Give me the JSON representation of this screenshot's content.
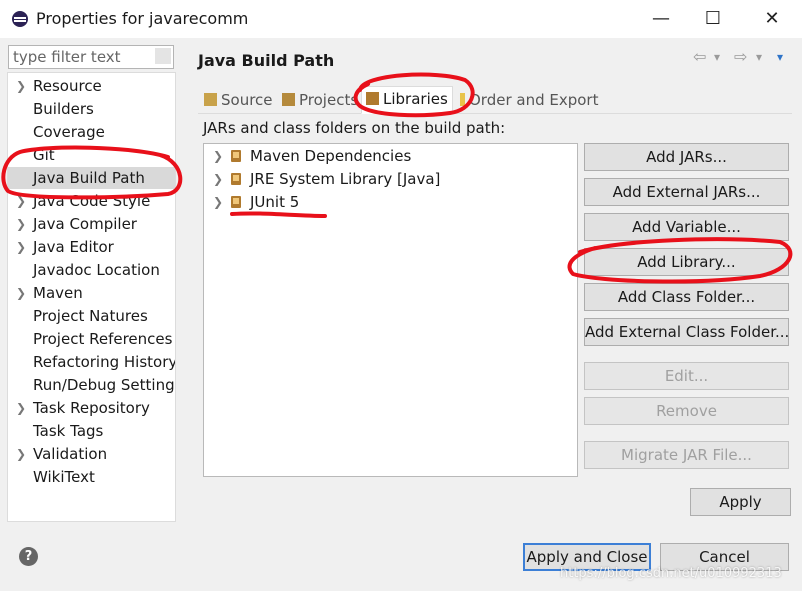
{
  "window": {
    "title": "Properties for javarecomm",
    "controls": [
      "—",
      "☐",
      "✕"
    ]
  },
  "filter": {
    "placeholder": "type filter text"
  },
  "tree": [
    {
      "label": "Resource",
      "expandable": true
    },
    {
      "label": "Builders",
      "expandable": false
    },
    {
      "label": "Coverage",
      "expandable": false
    },
    {
      "label": "Git",
      "expandable": false
    },
    {
      "label": "Java Build Path",
      "expandable": false,
      "selected": true
    },
    {
      "label": "Java Code Style",
      "expandable": true
    },
    {
      "label": "Java Compiler",
      "expandable": true
    },
    {
      "label": "Java Editor",
      "expandable": true
    },
    {
      "label": "Javadoc Location",
      "expandable": false
    },
    {
      "label": "Maven",
      "expandable": true
    },
    {
      "label": "Project Natures",
      "expandable": false
    },
    {
      "label": "Project References",
      "expandable": false
    },
    {
      "label": "Refactoring History",
      "expandable": false
    },
    {
      "label": "Run/Debug Setting",
      "expandable": false
    },
    {
      "label": "Task Repository",
      "expandable": true
    },
    {
      "label": "Task Tags",
      "expandable": false
    },
    {
      "label": "Validation",
      "expandable": true
    },
    {
      "label": "WikiText",
      "expandable": false
    }
  ],
  "page": {
    "title": "Java Build Path",
    "description": "JARs and class folders on the build path:"
  },
  "nav": {
    "back": "⇦",
    "forward": "⇨",
    "dropdown": "▾"
  },
  "tabs": [
    {
      "label": "Source",
      "icon": "source-folder-icon"
    },
    {
      "label": "Projects",
      "icon": "project-folder-icon"
    },
    {
      "label": "Libraries",
      "icon": "library-icon",
      "active": true
    },
    {
      "label": "Order and Export",
      "icon": "order-export-icon"
    }
  ],
  "libraries": [
    {
      "label": "Maven Dependencies"
    },
    {
      "label": "JRE System Library [Java]"
    },
    {
      "label": "JUnit 5"
    }
  ],
  "buttons": {
    "add_jars": "Add JARs...",
    "add_external_jars": "Add External JARs...",
    "add_variable": "Add Variable...",
    "add_library": "Add Library...",
    "add_class_folder": "Add Class Folder...",
    "add_external_class_folder": "Add External Class Folder...",
    "edit": "Edit...",
    "remove": "Remove",
    "migrate_jar": "Migrate JAR File...",
    "apply": "Apply",
    "apply_and_close": "Apply and Close",
    "cancel": "Cancel"
  },
  "help": {
    "glyph": "?"
  },
  "watermark": "https://blog.csdn.net/u010992313",
  "colors": {
    "annotation": "#e8101a",
    "focus": "#3c7fd6",
    "selection": "#d9d9d9"
  }
}
